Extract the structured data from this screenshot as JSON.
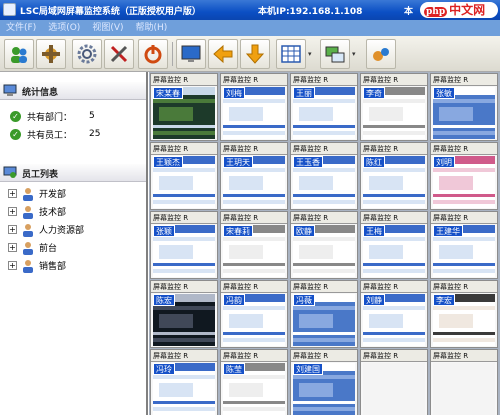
{
  "window": {
    "title": "LSC局域网屏幕监控系统（正版授权用户版）",
    "local_ip": "本机IP:192.168.1.108",
    "system_label": "本",
    "brand_tag": "php",
    "brand_text": "中文网"
  },
  "menu": [
    "文件(F)",
    "选项(O)",
    "视图(V)",
    "帮助(H)"
  ],
  "toolbar": {
    "icons": [
      "users-icon",
      "tools-icon",
      "gear-icon",
      "wrench-icon",
      "power-icon",
      "monitor-icon",
      "arrow-left-icon",
      "arrow-down-icon",
      "grid-icon",
      "screen-swap-icon",
      "transfer-icon"
    ]
  },
  "stats": {
    "heading": "统计信息",
    "departments_label": "共有部门：",
    "departments_value": "5",
    "employees_label": "共有员工：",
    "employees_value": "25"
  },
  "employees": {
    "heading": "员工列表",
    "departments": [
      "开发部",
      "技术部",
      "人力资源部",
      "前台",
      "销售部"
    ]
  },
  "grid": {
    "caption": "屏幕监控",
    "caption_suffix": "R",
    "cells": [
      {
        "name": "宋某春",
        "theme": "nature"
      },
      {
        "name": "刘梅",
        "theme": "web"
      },
      {
        "name": "王丽",
        "theme": "web"
      },
      {
        "name": "李奇",
        "theme": "doc"
      },
      {
        "name": "张敏",
        "theme": "desktop"
      },
      {
        "name": "王颖杰",
        "theme": "web"
      },
      {
        "name": "王玥天",
        "theme": "web"
      },
      {
        "name": "王玉香",
        "theme": "web"
      },
      {
        "name": "陈红",
        "theme": "web"
      },
      {
        "name": "刘明",
        "theme": "pink"
      },
      {
        "name": "张颖",
        "theme": "web"
      },
      {
        "name": "宋春莉",
        "theme": "doc"
      },
      {
        "name": "欧静",
        "theme": "doc"
      },
      {
        "name": "王梅",
        "theme": "web"
      },
      {
        "name": "王建华",
        "theme": "web"
      },
      {
        "name": "陈宏",
        "theme": "dark"
      },
      {
        "name": "冯韵",
        "theme": "web"
      },
      {
        "name": "冯薇",
        "theme": "desktop"
      },
      {
        "name": "刘静",
        "theme": "web"
      },
      {
        "name": "李宏",
        "theme": "portrait"
      },
      {
        "name": "冯玲",
        "theme": "web"
      },
      {
        "name": "陈莹",
        "theme": "doc"
      },
      {
        "name": "刘建国",
        "theme": "desktop"
      },
      {
        "name": "",
        "theme": "blank"
      },
      {
        "name": "",
        "theme": "blank"
      }
    ]
  },
  "colors": {
    "titlebar": "#0b4fc4",
    "menubar": "#6f9fdb",
    "name_tag": "#1651c8",
    "grid_bg": "#a9b3c2"
  }
}
